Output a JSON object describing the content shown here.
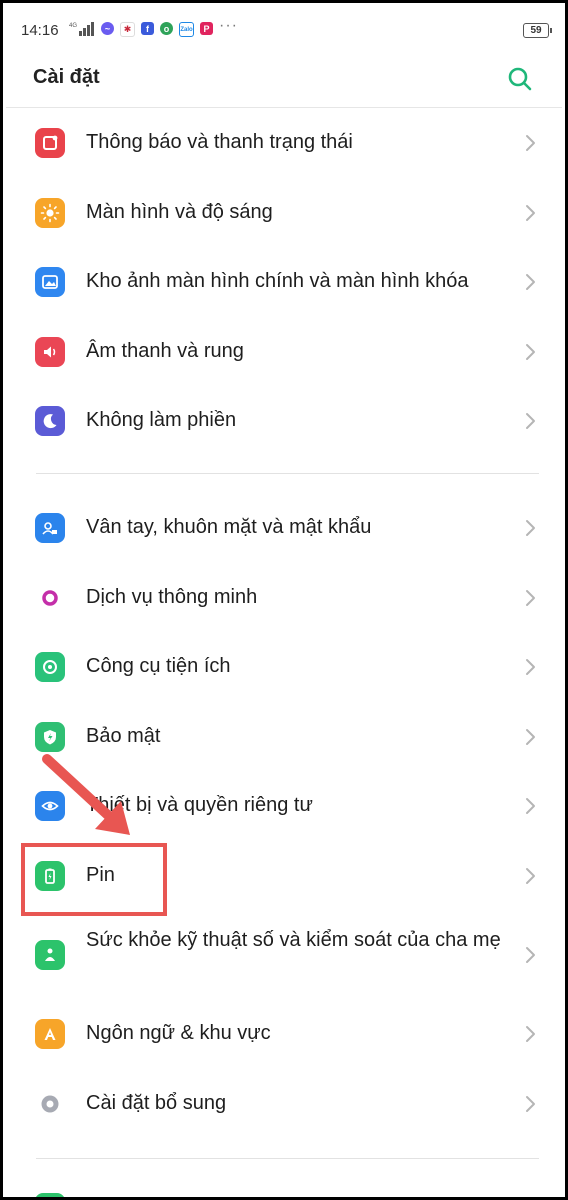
{
  "status_bar": {
    "time": "14:16",
    "network": "4G",
    "battery": "59",
    "overflow": "···",
    "notification_icons": [
      "messenger-icon",
      "news-icon",
      "facebook-icon",
      "app-icon",
      "zalo-icon",
      "pinterest-icon"
    ]
  },
  "header": {
    "title": "Cài đặt",
    "accent": "#1fb77a"
  },
  "groups": [
    [
      {
        "label": "Thông báo và thanh trạng thái",
        "icon": "notification-icon",
        "color": "#e9434b"
      },
      {
        "label": "Màn hình và độ sáng",
        "icon": "brightness-icon",
        "color": "#f7a529"
      },
      {
        "label": "Kho ảnh màn hình chính và màn hình khóa",
        "icon": "wallpaper-icon",
        "color": "#2f87f0"
      },
      {
        "label": "Âm thanh và rung",
        "icon": "sound-icon",
        "color": "#ea4655"
      },
      {
        "label": "Không làm phiền",
        "icon": "moon-icon",
        "color": "#5b5bd6"
      }
    ],
    [
      {
        "label": "Vân tay, khuôn mặt và mật khẩu",
        "icon": "fingerprint-face-icon",
        "color": "#2b84ec"
      },
      {
        "label": "Dịch vụ thông minh",
        "icon": "smart-service-icon",
        "color": "#c42fa9"
      },
      {
        "label": "Công cụ tiện ích",
        "icon": "tools-icon",
        "color": "#29c27a"
      },
      {
        "label": "Bảo mật",
        "icon": "shield-icon",
        "color": "#2fbf73"
      },
      {
        "label": "Thiết bị và quyền riêng tư",
        "icon": "privacy-eye-icon",
        "color": "#2b84ec"
      },
      {
        "label": "Pin",
        "icon": "battery-icon",
        "color": "#2cc36b"
      },
      {
        "label": "Sức khỏe kỹ thuật số và kiểm soát của cha mẹ",
        "icon": "digital-wellbeing-icon",
        "color": "#2cc36b"
      },
      {
        "label": "Ngôn ngữ & khu vực",
        "icon": "language-icon",
        "color": "#f7a529"
      },
      {
        "label": "Cài đặt bổ sung",
        "icon": "extra-settings-icon",
        "color": "#a7aab3"
      }
    ]
  ],
  "annotation": {
    "color": "#e85652"
  }
}
